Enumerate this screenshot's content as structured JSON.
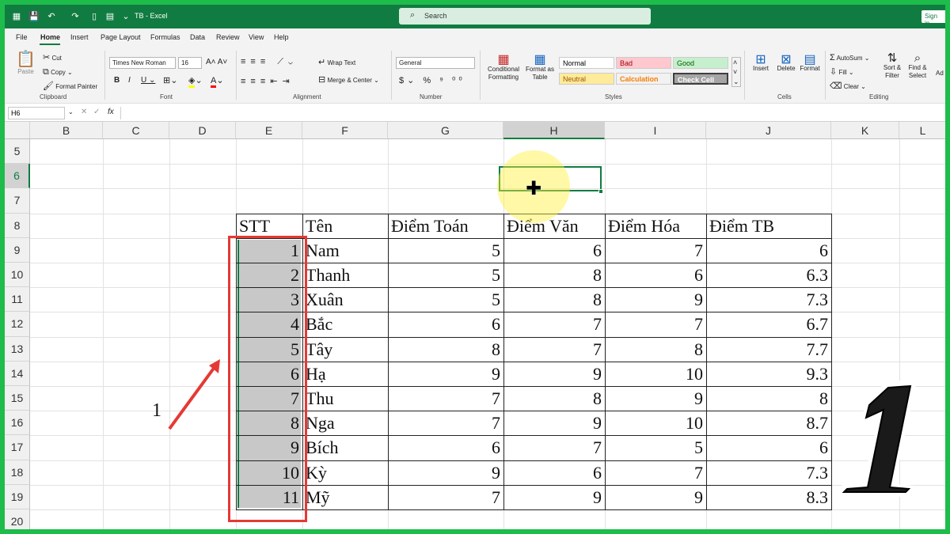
{
  "titlebar": {
    "doc_title": "TB - Excel",
    "search_placeholder": "Search",
    "signin": "Sign in"
  },
  "menu": [
    "File",
    "Home",
    "Insert",
    "Page Layout",
    "Formulas",
    "Data",
    "Review",
    "View",
    "Help"
  ],
  "ribbon": {
    "clipboard": {
      "paste": "Paste",
      "cut": "Cut",
      "copy": "Copy",
      "format_painter": "Format Painter",
      "label": "Clipboard"
    },
    "font": {
      "name": "Times New Roman",
      "size": "16",
      "label": "Font"
    },
    "alignment": {
      "wrap": "Wrap Text",
      "merge": "Merge & Center",
      "label": "Alignment"
    },
    "number": {
      "format": "General",
      "label": "Number"
    },
    "styles": {
      "conditional": "Conditional Formatting",
      "format_table": "Format as Table",
      "cells": [
        {
          "name": "Normal",
          "bg": "#ffffff",
          "fg": "#000000"
        },
        {
          "name": "Bad",
          "bg": "#ffc7ce",
          "fg": "#9c0006"
        },
        {
          "name": "Good",
          "bg": "#c6efce",
          "fg": "#006100"
        },
        {
          "name": "Neutral",
          "bg": "#ffeb9c",
          "fg": "#9c5700"
        },
        {
          "name": "Calculation",
          "bg": "#f2f2f2",
          "fg": "#fa7d00"
        },
        {
          "name": "Check Cell",
          "bg": "#a5a5a5",
          "fg": "#ffffff"
        }
      ],
      "label": "Styles"
    },
    "cells_group": {
      "insert": "Insert",
      "delete": "Delete",
      "format": "Format",
      "label": "Cells"
    },
    "editing": {
      "autosum": "AutoSum",
      "fill": "Fill",
      "clear": "Clear",
      "sort": "Sort & Filter",
      "find": "Find & Select",
      "label": "Editing",
      "extra": "Ad"
    }
  },
  "formula_bar": {
    "name_box": "H6",
    "fx": "fx"
  },
  "columns": [
    "B",
    "C",
    "D",
    "E",
    "F",
    "G",
    "H",
    "I",
    "J",
    "K",
    "L"
  ],
  "rows": [
    "5",
    "6",
    "7",
    "8",
    "9",
    "10",
    "11",
    "12",
    "13",
    "14",
    "15",
    "16",
    "17",
    "18",
    "19",
    "20"
  ],
  "selected_cell": "H6",
  "table": {
    "headers": [
      "STT",
      "Tên",
      "Điểm Toán",
      "Điểm Văn",
      "Điểm Hóa",
      "Điểm TB"
    ],
    "rows": [
      [
        "1",
        "Nam",
        "5",
        "6",
        "7",
        "6"
      ],
      [
        "2",
        "Thanh",
        "5",
        "8",
        "6",
        "6.3"
      ],
      [
        "3",
        "Xuân",
        "5",
        "8",
        "9",
        "7.3"
      ],
      [
        "4",
        "Bắc",
        "6",
        "7",
        "7",
        "6.7"
      ],
      [
        "5",
        "Tây",
        "8",
        "7",
        "8",
        "7.7"
      ],
      [
        "6",
        "Hạ",
        "9",
        "9",
        "10",
        "9.3"
      ],
      [
        "7",
        "Thu",
        "7",
        "8",
        "9",
        "8"
      ],
      [
        "8",
        "Nga",
        "7",
        "9",
        "10",
        "8.7"
      ],
      [
        "9",
        "Bích",
        "6",
        "7",
        "5",
        "6"
      ],
      [
        "10",
        "Kỳ",
        "9",
        "6",
        "7",
        "7.3"
      ],
      [
        "11",
        "Mỹ",
        "7",
        "9",
        "9",
        "8.3"
      ]
    ]
  },
  "annotation": {
    "label": "1",
    "color": "#e53935"
  },
  "badge": "1",
  "accent": "#107c41"
}
